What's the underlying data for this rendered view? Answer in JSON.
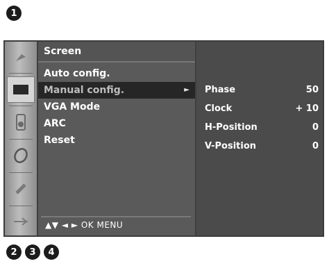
{
  "badges": {
    "top": "1",
    "bottom": [
      "2",
      "3",
      "4"
    ]
  },
  "icons": [
    "picture-icon",
    "screen-icon",
    "audio-icon",
    "option-icon",
    "time-icon",
    "input-icon"
  ],
  "menu": {
    "title": "Screen",
    "items": [
      {
        "label": "Auto config.",
        "selected": false
      },
      {
        "label": "Manual config.",
        "selected": true,
        "arrow": "►"
      },
      {
        "label": "VGA Mode",
        "selected": false
      },
      {
        "label": "ARC",
        "selected": false
      },
      {
        "label": "Reset",
        "selected": false
      }
    ],
    "footer": "▲▼ ◄ ► OK MENU"
  },
  "submenu": {
    "rows": [
      {
        "label": "Phase",
        "value": "50"
      },
      {
        "label": "Clock",
        "value": "+ 10"
      },
      {
        "label": "H-Position",
        "value": "0"
      },
      {
        "label": "V-Position",
        "value": "0"
      }
    ]
  },
  "colors": {
    "osd_bg": "#5a5a5a",
    "selected_row": "#262626",
    "submenu_bg": "#4b4b4b"
  }
}
